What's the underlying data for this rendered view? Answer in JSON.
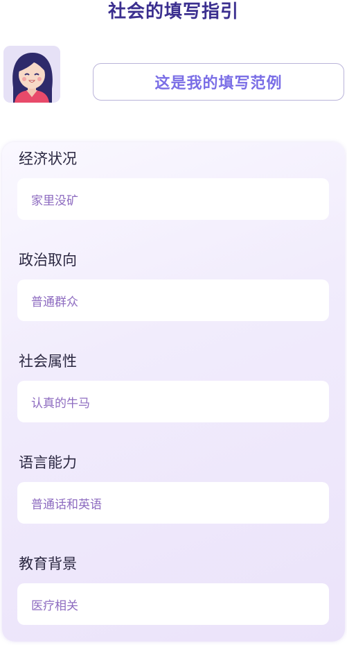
{
  "page": {
    "title": "社会的填写指引",
    "example_button_label": "这是我的填写范例"
  },
  "fields": [
    {
      "label": "经济状况",
      "value": "家里没矿"
    },
    {
      "label": "政治取向",
      "value": "普通群众"
    },
    {
      "label": "社会属性",
      "value": "认真的牛马"
    },
    {
      "label": "语言能力",
      "value": "普通话和英语"
    },
    {
      "label": "教育背景",
      "value": "医疗相关"
    }
  ],
  "icons": {
    "avatar": "girl-avatar-icon"
  },
  "colors": {
    "title": "#3b2f8f",
    "accent": "#7a6ee6",
    "value_text": "#8d6bc0",
    "card_bg": "#efe9fb"
  }
}
